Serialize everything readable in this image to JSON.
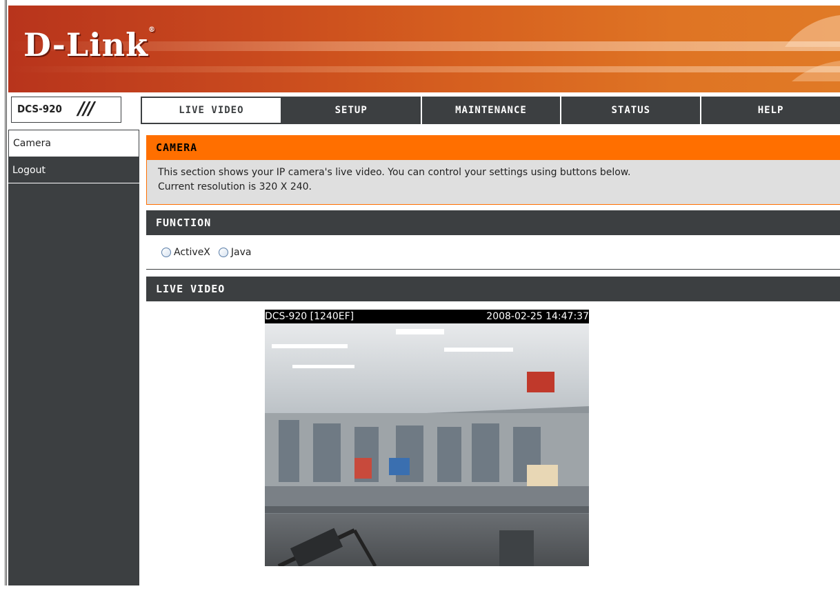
{
  "brand": {
    "logo": "D-Link",
    "reg": "®"
  },
  "nav": {
    "model": "DCS-920",
    "slashes": "///",
    "tabs": [
      {
        "label": "LIVE VIDEO",
        "active": true
      },
      {
        "label": "SETUP",
        "active": false
      },
      {
        "label": "MAINTENANCE",
        "active": false
      },
      {
        "label": "STATUS",
        "active": false
      },
      {
        "label": "HELP",
        "active": false
      }
    ]
  },
  "sidebar": {
    "items": [
      {
        "label": "Camera",
        "active": true
      },
      {
        "label": "Logout",
        "active": false
      }
    ]
  },
  "camera_section": {
    "title": "CAMERA",
    "line1": "This section shows your IP camera's live video. You can control your settings using buttons below.",
    "line2": "Current resolution is 320 X 240."
  },
  "function_section": {
    "title": "FUNCTION",
    "options": [
      "ActiveX",
      "Java"
    ]
  },
  "live_video_section": {
    "title": "LIVE VIDEO",
    "camera_name": "DCS-920 [1240EF]",
    "timestamp": "2008-02-25 14:47:37"
  },
  "colors": {
    "orange": "#ff6f00",
    "dark": "#3c3f41",
    "banner": "#c94a1e"
  }
}
